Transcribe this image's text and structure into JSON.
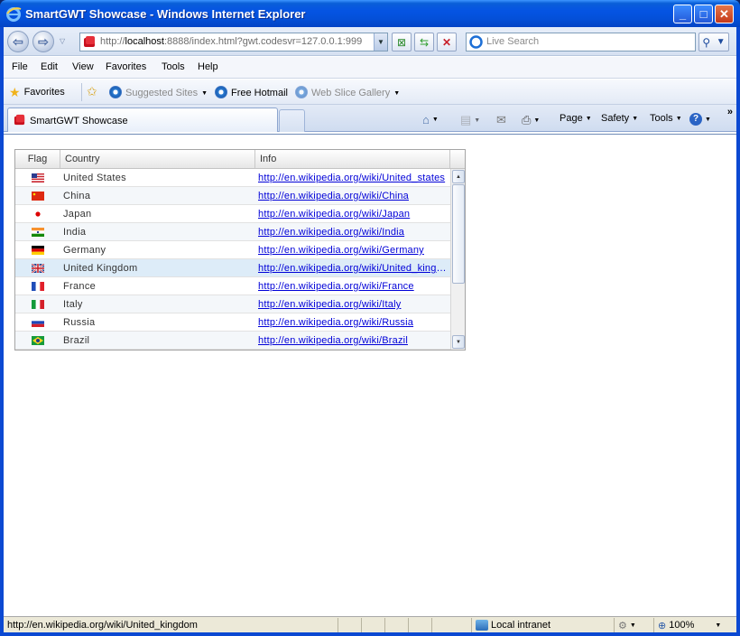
{
  "window": {
    "title": "SmartGWT Showcase - Windows Internet Explorer",
    "controls": {
      "minimize": "_",
      "maximize": "□",
      "close": "✕"
    }
  },
  "toolbar": {
    "address_prefix": "http://",
    "address_host": "localhost",
    "address_rest": ":8888/index.html?gwt.codesvr=127.0.0.1:999",
    "search_placeholder": "Live Search"
  },
  "menu": [
    "File",
    "Edit",
    "View",
    "Favorites",
    "Tools",
    "Help"
  ],
  "favorites_bar": {
    "favorites_label": "Favorites",
    "suggested_sites": "Suggested Sites",
    "free_hotmail": "Free Hotmail",
    "web_slice_gallery": "Web Slice Gallery"
  },
  "tabs": [
    {
      "label": "SmartGWT Showcase",
      "active": true
    }
  ],
  "commands": {
    "page": "Page",
    "safety": "Safety",
    "tools": "Tools",
    "more": "»"
  },
  "grid": {
    "columns": [
      "Flag",
      "Country",
      "Info"
    ],
    "rows": [
      {
        "flag": "us",
        "country": "United States",
        "info": "http://en.wikipedia.org/wiki/United_states"
      },
      {
        "flag": "cn",
        "country": "China",
        "info": "http://en.wikipedia.org/wiki/China"
      },
      {
        "flag": "jp",
        "country": "Japan",
        "info": "http://en.wikipedia.org/wiki/Japan"
      },
      {
        "flag": "in",
        "country": "India",
        "info": "http://en.wikipedia.org/wiki/India"
      },
      {
        "flag": "de",
        "country": "Germany",
        "info": "http://en.wikipedia.org/wiki/Germany"
      },
      {
        "flag": "gb",
        "country": "United Kingdom",
        "info": "http://en.wikipedia.org/wiki/United_kingdom",
        "hover": true
      },
      {
        "flag": "fr",
        "country": "France",
        "info": "http://en.wikipedia.org/wiki/France"
      },
      {
        "flag": "it",
        "country": "Italy",
        "info": "http://en.wikipedia.org/wiki/Italy"
      },
      {
        "flag": "ru",
        "country": "Russia",
        "info": "http://en.wikipedia.org/wiki/Russia"
      },
      {
        "flag": "br",
        "country": "Brazil",
        "info": "http://en.wikipedia.org/wiki/Brazil"
      }
    ]
  },
  "status": {
    "url": "http://en.wikipedia.org/wiki/United_kingdom",
    "zone": "Local intranet",
    "zoom": "100%"
  }
}
